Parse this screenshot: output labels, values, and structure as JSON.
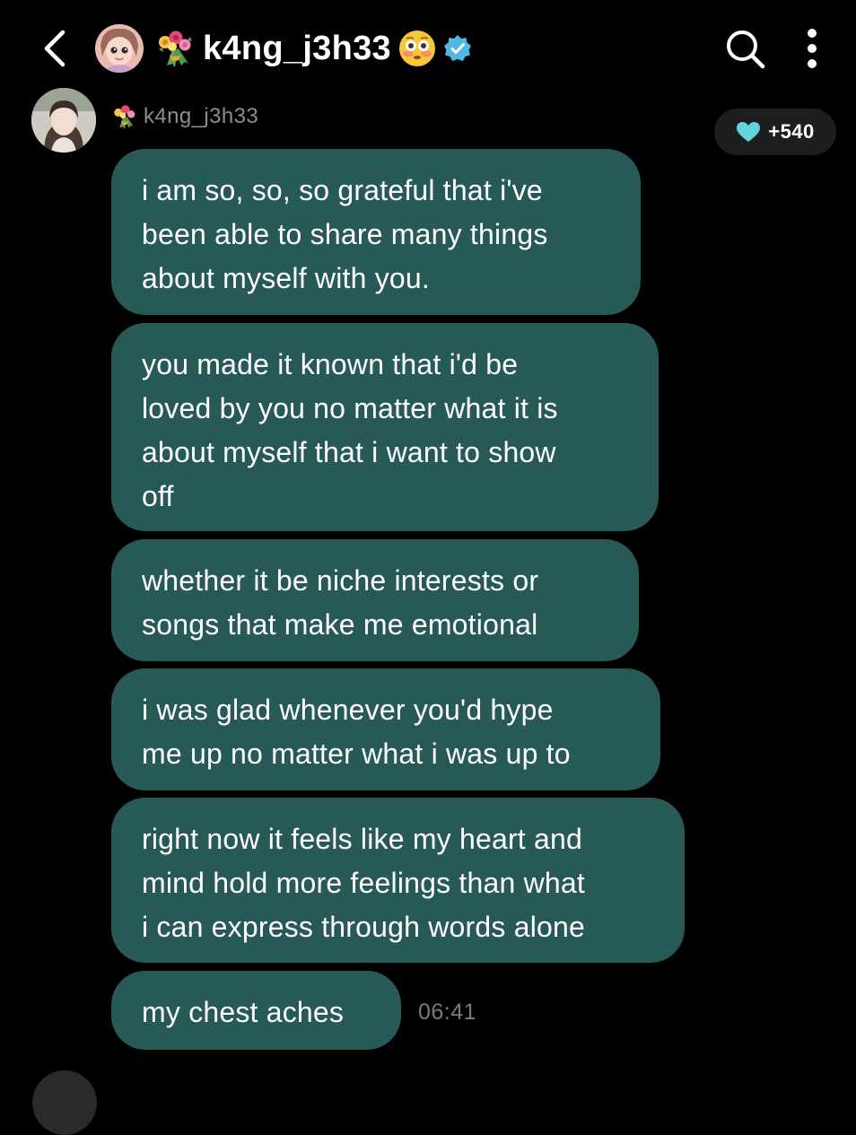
{
  "header": {
    "username": "k4ng_j3h33",
    "back_icon": "chevron-left-icon",
    "search_icon": "search-icon",
    "more_icon": "more-vertical-icon",
    "verified_icon": "verified-badge-icon",
    "emoji_icon": "flushed-face-icon",
    "prefix_icon": "bouquet-icon",
    "verified_color": "#4fb9e3"
  },
  "sender": {
    "name": "k4ng_j3h33",
    "prefix_icon": "bouquet-icon"
  },
  "likes": {
    "count": "+540",
    "icon": "heart-icon",
    "color": "#62d4dc"
  },
  "messages": [
    {
      "text": "i am so, so, so grateful that i've\nbeen able to share many things\nabout myself with you."
    },
    {
      "text": "you made it known that i'd be\nloved by you no matter what it is\nabout myself that i want to show\noff"
    },
    {
      "text": "whether it be niche interests or\nsongs that make me emotional"
    },
    {
      "text": "i was glad whenever you'd hype\nme up no matter what i was up to"
    },
    {
      "text": "right now it feels like my heart and\nmind hold more feelings than what\ni can express through words alone"
    },
    {
      "text": "my chest aches"
    }
  ],
  "last_message_time": "06:41",
  "colors": {
    "background": "#000000",
    "bubble": "#275a56",
    "muted_text": "#8d8d8d"
  }
}
